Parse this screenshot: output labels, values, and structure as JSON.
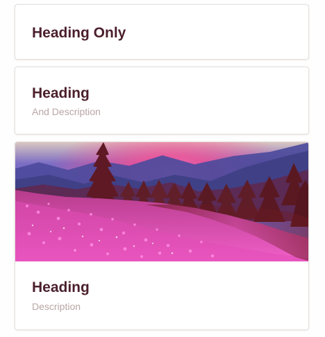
{
  "cards": [
    {
      "title": "Heading Only"
    },
    {
      "title": "Heading",
      "description": "And Description"
    },
    {
      "title": "Heading",
      "description": "Description"
    }
  ],
  "colors": {
    "title": "#4b1f2c",
    "description": "#b9a6a4",
    "border": "#e6e1de",
    "background": "#fefefe"
  }
}
